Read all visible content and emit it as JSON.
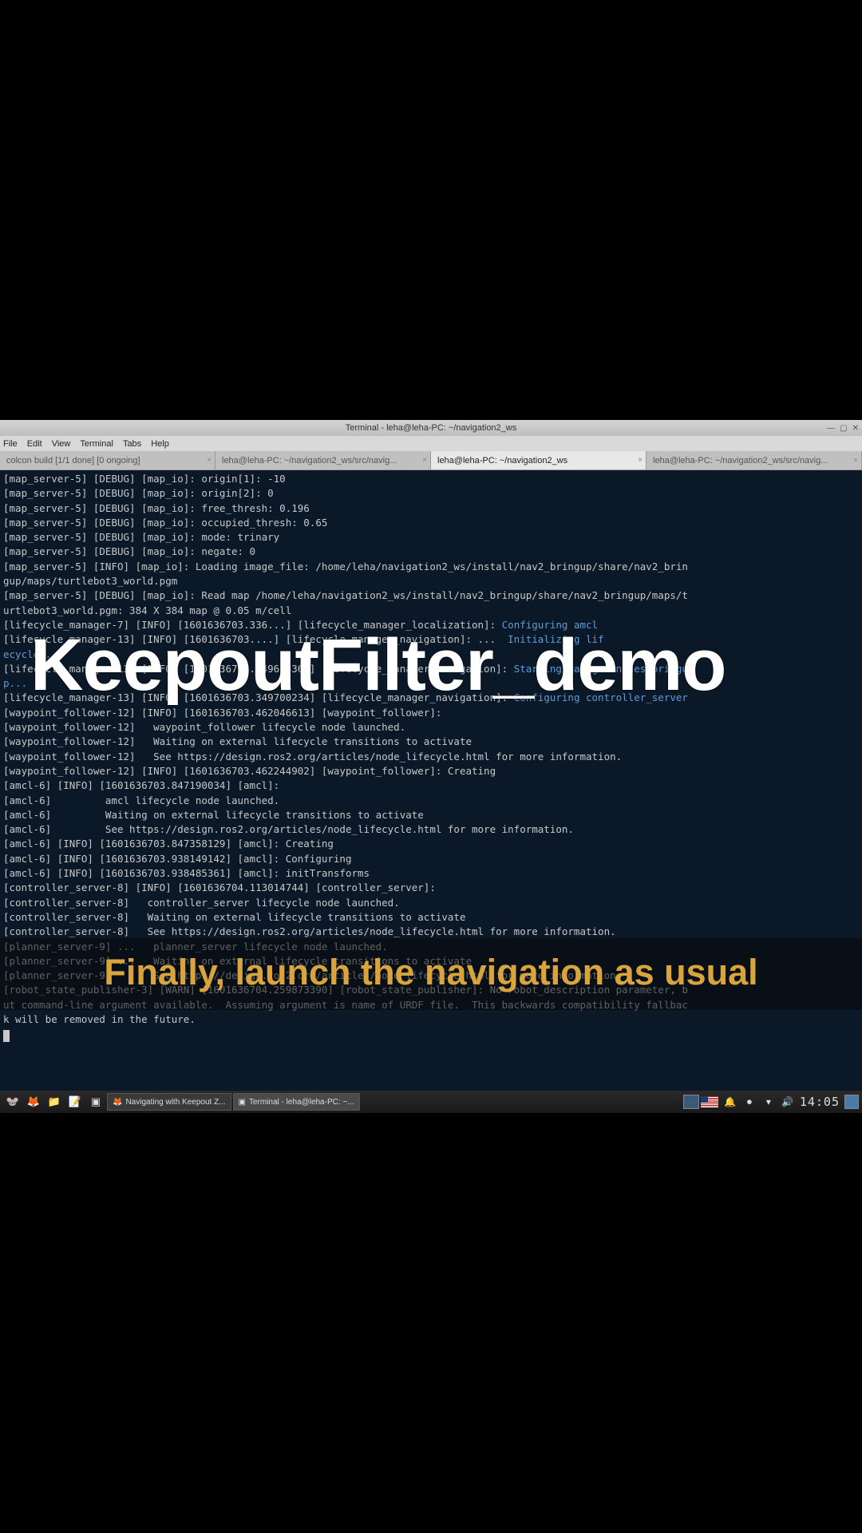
{
  "window": {
    "title": "Terminal - leha@leha-PC: ~/navigation2_ws"
  },
  "menubar": {
    "file": "File",
    "edit": "Edit",
    "view": "View",
    "terminal": "Terminal",
    "tabs": "Tabs",
    "help": "Help"
  },
  "tabs": [
    {
      "label": "colcon build [1/1 done] [0 ongoing]"
    },
    {
      "label": "leha@leha-PC: ~/navigation2_ws/src/navig..."
    },
    {
      "label": "leha@leha-PC: ~/navigation2_ws"
    },
    {
      "label": "leha@leha-PC: ~/navigation2_ws/src/navig..."
    }
  ],
  "terminal_lines": [
    {
      "t": "[map_server-5] [DEBUG] [map_io]: origin[1]: -10"
    },
    {
      "t": "[map_server-5] [DEBUG] [map_io]: origin[2]: 0"
    },
    {
      "t": "[map_server-5] [DEBUG] [map_io]: free_thresh: 0.196"
    },
    {
      "t": "[map_server-5] [DEBUG] [map_io]: occupied_thresh: 0.65"
    },
    {
      "t": "[map_server-5] [DEBUG] [map_io]: mode: trinary"
    },
    {
      "t": "[map_server-5] [DEBUG] [map_io]: negate: 0"
    },
    {
      "t": "[map_server-5] [INFO] [map_io]: Loading image_file: /home/leha/navigation2_ws/install/nav2_bringup/share/nav2_brin"
    },
    {
      "t": "gup/maps/turtlebot3_world.pgm"
    },
    {
      "t": "[map_server-5] [DEBUG] [map_io]: Read map /home/leha/navigation2_ws/install/nav2_bringup/share/nav2_bringup/maps/t"
    },
    {
      "t": "urtlebot3_world.pgm: 384 X 384 map @ 0.05 m/cell"
    },
    {
      "t": "[lifecycle_manager-7] [INFO] [1601636703.336...] [lifecycle_manager_localization]: ",
      "tail": "Configuring amcl",
      "tail_class": "info-blue"
    },
    {
      "t": "[lifecycle_manager-13] [INFO] [1601636703....] [lifecycle_manager_navigation]: ...  ",
      "tail": "Initializing lif",
      "tail_class": "info-blue"
    },
    {
      "t": "ecycle...",
      "class": "info-blue"
    },
    {
      "t": "[lifecycle_manager-13] [INFO] [1601636703.349654360] [lifecycle_manager_navigation]: ",
      "tail": "Starting managed nodes bringu",
      "tail_class": "info-blue"
    },
    {
      "t": "p...",
      "class": "info-blue"
    },
    {
      "t": "[lifecycle_manager-13] [INFO] [1601636703.349700234] [lifecycle_manager_navigation]: ",
      "tail": "Configuring controller_server",
      "tail_class": "info-blue"
    },
    {
      "t": "[waypoint_follower-12] [INFO] [1601636703.462046613] [waypoint_follower]:"
    },
    {
      "t": "[waypoint_follower-12]   waypoint_follower lifecycle node launched."
    },
    {
      "t": "[waypoint_follower-12]   Waiting on external lifecycle transitions to activate"
    },
    {
      "t": "[waypoint_follower-12]   See https://design.ros2.org/articles/node_lifecycle.html for more information."
    },
    {
      "t": "[waypoint_follower-12] [INFO] [1601636703.462244902] [waypoint_follower]: Creating"
    },
    {
      "t": "[amcl-6] [INFO] [1601636703.847190034] [amcl]:"
    },
    {
      "t": "[amcl-6]         amcl lifecycle node launched."
    },
    {
      "t": "[amcl-6]         Waiting on external lifecycle transitions to activate"
    },
    {
      "t": "[amcl-6]         See https://design.ros2.org/articles/node_lifecycle.html for more information."
    },
    {
      "t": "[amcl-6] [INFO] [1601636703.847358129] [amcl]: Creating"
    },
    {
      "t": "[amcl-6] [INFO] [1601636703.938149142] [amcl]: Configuring"
    },
    {
      "t": "[amcl-6] [INFO] [1601636703.938485361] [amcl]: initTransforms"
    },
    {
      "t": "[controller_server-8] [INFO] [1601636704.113014744] [controller_server]:"
    },
    {
      "t": "[controller_server-8]   controller_server lifecycle node launched."
    },
    {
      "t": "[controller_server-8]   Waiting on external lifecycle transitions to activate"
    },
    {
      "t": "[controller_server-8]   See https://design.ros2.org/articles/node_lifecycle.html for more information."
    },
    {
      "t": "[planner_server-9] ...   planner_server lifecycle node launched."
    },
    {
      "t": "[planner_server-9] ...   Waiting on external lifecycle transitions to activate"
    },
    {
      "t": "[planner_server-9]       See https://design.ros2.org/articles/node_lifecycle.html for more information."
    },
    {
      "t": "[robot_state_publisher-3] [WARN] [1601636704.259873390] [robot_state_publisher]: No robot_description parameter, b"
    },
    {
      "t": "ut command-line argument available.  Assuming argument is name of URDF file.  This backwards compatibility fallbac"
    },
    {
      "t": "k will be removed in the future."
    }
  ],
  "taskbar": {
    "items": [
      {
        "icon": "🦊",
        "label": "Navigating with Keepout Z..."
      },
      {
        "icon": "▣",
        "label": "Terminal - leha@leha-PC: ~..."
      }
    ],
    "clock": "14:05"
  },
  "overlay": {
    "title": "KeepoutFilter_demo",
    "caption": "Finally, launch the navigation as usual"
  }
}
